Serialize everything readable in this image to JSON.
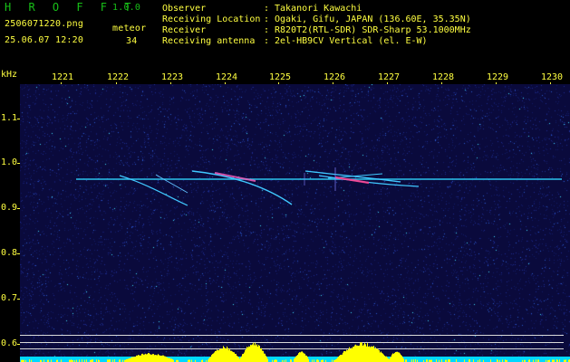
{
  "app": {
    "logo": "H R O F F T",
    "version": "1.0.0"
  },
  "capture": {
    "filename": "2506071220.png",
    "datetime": "25.06.07 12:20",
    "meteor_label": "meteor",
    "meteor_count": "34"
  },
  "info": [
    {
      "key": "Observer",
      "value": "Takanori Kawachi"
    },
    {
      "key": "Receiving Location",
      "value": "Ogaki, Gifu, JAPAN (136.60E, 35.35N)"
    },
    {
      "key": "Receiver",
      "value": "R820T2(RTL-SDR) SDR-Sharp 53.1000MHz"
    },
    {
      "key": "Receiving antenna",
      "value": "2el-HB9CV Vertical (el. E-W)"
    }
  ],
  "axes": {
    "y_unit": "kHz",
    "y_ticks": [
      "1.1",
      "1.0",
      "0.9",
      "0.8",
      "0.7",
      "0.6"
    ],
    "x_ticks": [
      "1221",
      "1222",
      "1223",
      "1224",
      "1225",
      "1226",
      "1227",
      "1228",
      "1229",
      "1230"
    ]
  },
  "colors": {
    "background": "#000000",
    "plot_background": "#0a0a3c",
    "text_yellow": "#ffff40",
    "logo_green": "#18c018",
    "carrier": "#30e0ff",
    "power_bar": "#ffff00",
    "baseline": "#00e0ff"
  }
}
